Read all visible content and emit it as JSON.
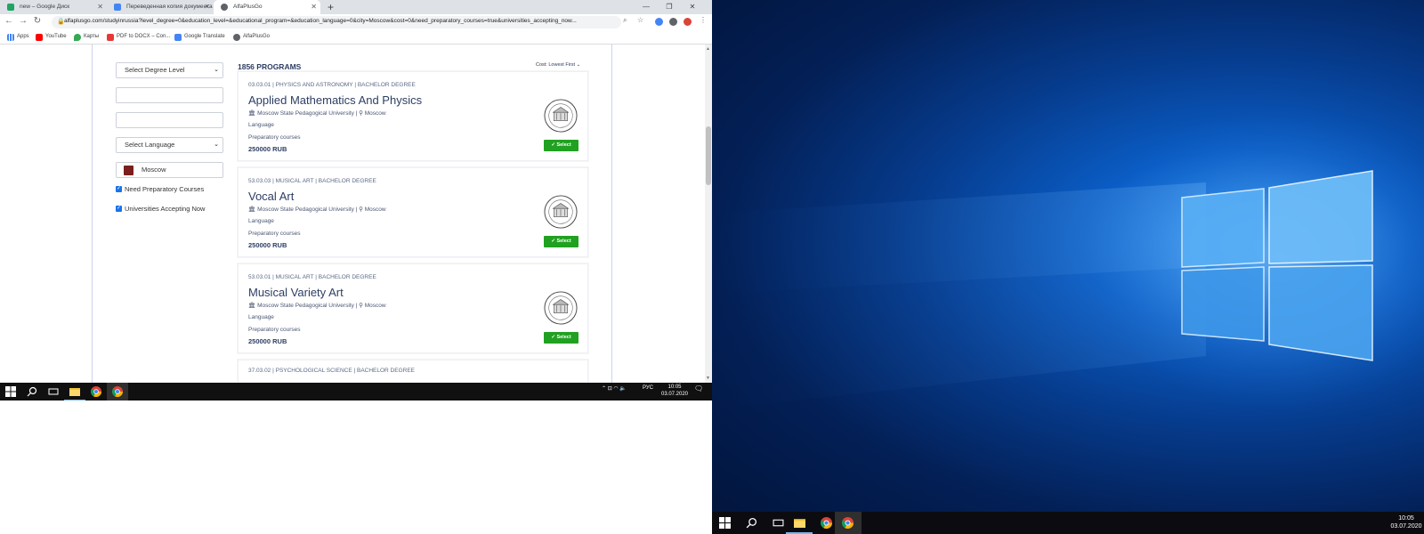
{
  "browser": {
    "tabs": [
      {
        "title": "new – Google Диск",
        "favicon_color": "#1fa463"
      },
      {
        "title": "Переведенная копия документа",
        "favicon_color": "#4285f4"
      },
      {
        "title": "AlfaPlusGo",
        "favicon_color": "#5f6368"
      }
    ],
    "url": "alfaplusgo.com/studyinrussia?level_degree=0&education_level=&educational_program=&education_language=0&city=Moscow&cost=0&need_preparatory_courses=true&universities_accepting_now...",
    "bookmarks": [
      "Apps",
      "YouTube",
      "Карты",
      "PDF to DOCX – Con...",
      "Google Translate",
      "AlfaPlusGo"
    ]
  },
  "filters": {
    "degree_select": "Select Degree Level",
    "text_field_1": "",
    "text_field_2": "",
    "language_select": "Select Language",
    "city": "Moscow",
    "need_prep_label": "Need Preparatory Courses",
    "accepting_label": "Universities Accepting Now"
  },
  "results": {
    "count_label": "1856 PROGRAMS",
    "sort_label": "Cost:",
    "sort_value": "Lowest First"
  },
  "programs": [
    {
      "code": "03.03.01 | PHYSICS AND ASTRONOMY | BACHELOR DEGREE",
      "title": "Applied Mathematics And Physics",
      "university": "Moscow State Pedagogical University",
      "city": "Moscow",
      "language": "Language",
      "prep": "Preparatory courses",
      "price": "250000 RUB",
      "button": "Select"
    },
    {
      "code": "53.03.03 | MUSICAL ART | BACHELOR DEGREE",
      "title": "Vocal Art",
      "university": "Moscow State Pedagogical University",
      "city": "Moscow",
      "language": "Language",
      "prep": "Preparatory courses",
      "price": "250000 RUB",
      "button": "Select"
    },
    {
      "code": "53.03.01 | MUSICAL ART | BACHELOR DEGREE",
      "title": "Musical Variety Art",
      "university": "Moscow State Pedagogical University",
      "city": "Moscow",
      "language": "Language",
      "prep": "Preparatory courses",
      "price": "250000 RUB",
      "button": "Select"
    },
    {
      "code": "37.03.02 | PSYCHOLOGICAL SCIENCE | BACHELOR DEGREE"
    }
  ],
  "taskbar_left": {
    "lang": "РУС",
    "time": "10:05",
    "date": "03.07.2020"
  },
  "taskbar_right": {
    "time": "10:05",
    "date": "03.07.2020"
  },
  "colors": {
    "accent_green": "#21a121",
    "heading_navy": "#2d3e63",
    "taskbar": "#101010"
  }
}
